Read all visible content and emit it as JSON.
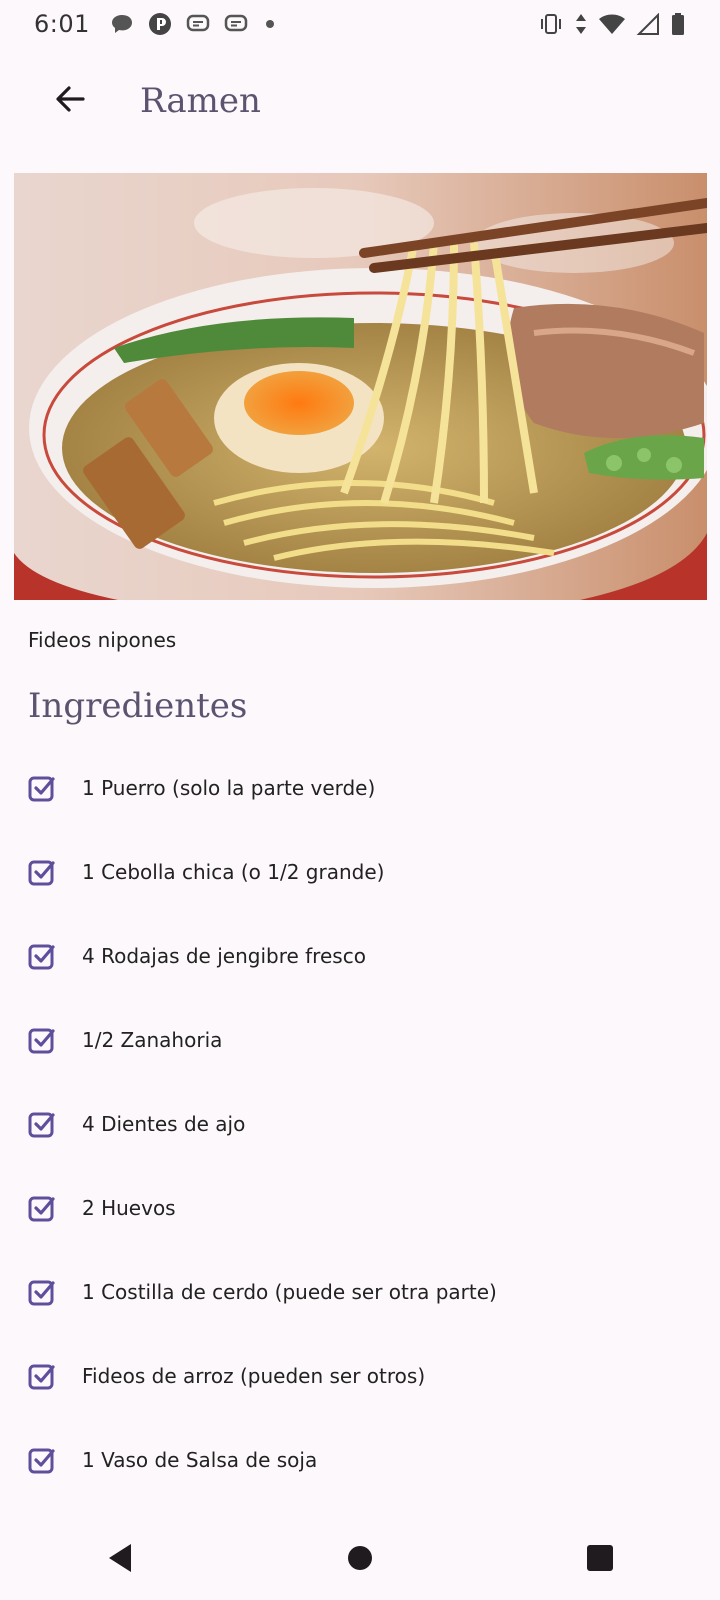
{
  "status_bar": {
    "time": "6:01",
    "left_icons": [
      "chat-bubble-icon",
      "app-p-icon",
      "message-icon",
      "message-icon",
      "dot-icon"
    ],
    "right_icons": [
      "vibrate-icon",
      "data-arrows-icon",
      "wifi-icon",
      "signal-icon",
      "battery-icon"
    ]
  },
  "app_bar": {
    "back_icon": "arrow-left-icon",
    "title": "Ramen"
  },
  "recipe": {
    "image_description_icon": "ramen-photo",
    "subtitle": "Fideos nipones",
    "section_title": "Ingredientes",
    "ingredients": [
      "1 Puerro (solo la parte verde)",
      "1 Cebolla chica (o 1/2 grande)",
      "4 Rodajas de jengibre fresco",
      "1/2 Zanahoria",
      "4 Dientes de ajo",
      "2 Huevos",
      "1 Costilla de cerdo (puede ser otra parte)",
      "Fideos de arroz (pueden ser otros)",
      "1 Vaso de Salsa de soja"
    ]
  },
  "nav_bar": {
    "icons": [
      "back-triangle-icon",
      "home-circle-icon",
      "recents-square-icon"
    ]
  },
  "colors": {
    "accent": "#5e4f9c",
    "title": "#5b5470",
    "background": "#fdf8fb"
  }
}
